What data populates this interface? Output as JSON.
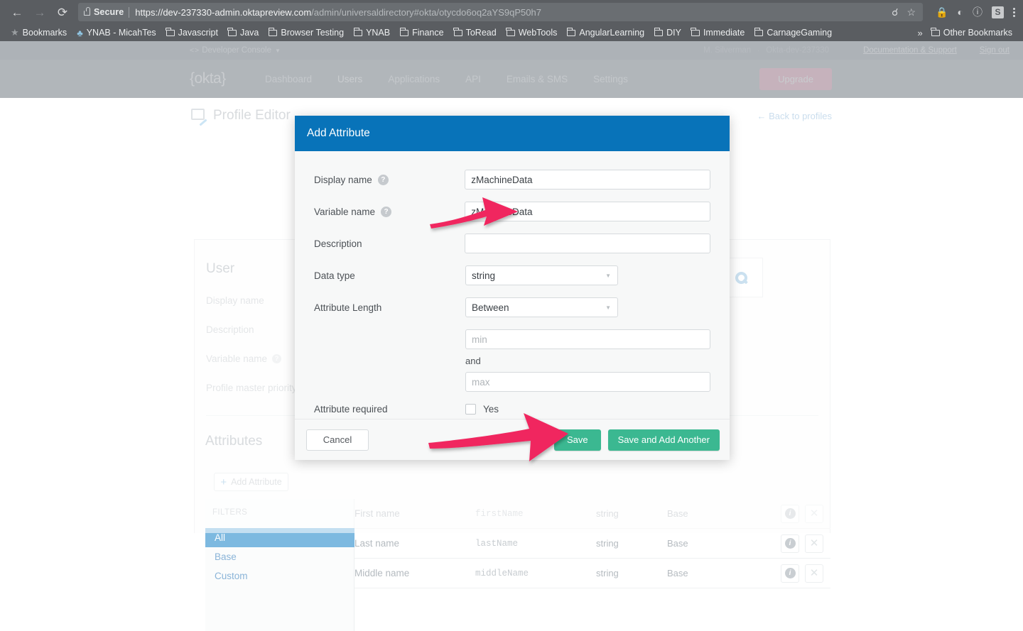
{
  "browser": {
    "nav": {
      "back": "←",
      "forward": "→",
      "reload": "⟳"
    },
    "security_label": "Secure",
    "url_strong": "https://dev-237330-admin.oktapreview.com",
    "url_dim": "/admin/universaldirectory#okta/otycdo6oq2aYS9qP50h7",
    "omni_icons": [
      "zoom-out-icon",
      "bookmark-star-icon"
    ],
    "toolbar_icons": [
      "lock-icon",
      "dark-mode-icon",
      "info-circle-icon"
    ],
    "extension_badge": "S",
    "menu_icon": "kebab-menu-icon",
    "bookmarks": [
      {
        "label": "Bookmarks",
        "icon": "star-icon"
      },
      {
        "label": "YNAB - MicahTes",
        "icon": "tree-icon"
      },
      {
        "label": "Javascript",
        "icon": "folder-icon"
      },
      {
        "label": "Java",
        "icon": "folder-icon"
      },
      {
        "label": "Browser Testing",
        "icon": "folder-icon"
      },
      {
        "label": "YNAB",
        "icon": "folder-icon"
      },
      {
        "label": "Finance",
        "icon": "folder-icon"
      },
      {
        "label": "ToRead",
        "icon": "folder-icon"
      },
      {
        "label": "WebTools",
        "icon": "folder-icon"
      },
      {
        "label": "AngularLearning",
        "icon": "folder-icon"
      },
      {
        "label": "DIY",
        "icon": "folder-icon"
      },
      {
        "label": "Immediate",
        "icon": "folder-icon"
      },
      {
        "label": "CarnageGaming",
        "icon": "folder-icon"
      }
    ],
    "overflow_label": "»",
    "other_bookmarks": "Other Bookmarks"
  },
  "okta": {
    "topbar": {
      "console_label": "Developer Console",
      "console_caret": "▼",
      "user": "M. Silverman",
      "separator": "·",
      "org": "Okta-dev-237330",
      "docs_link": "Documentation & Support",
      "signout_link": "Sign out"
    },
    "nav": {
      "logo": "{okta}",
      "items": [
        {
          "label": "Dashboard",
          "active": false
        },
        {
          "label": "Users",
          "active": true
        },
        {
          "label": "Applications",
          "active": false
        },
        {
          "label": "API",
          "active": false
        },
        {
          "label": "Emails & SMS",
          "active": false
        },
        {
          "label": "Settings",
          "active": false
        }
      ],
      "upgrade_label": "Upgrade"
    },
    "page": {
      "title": "Profile Editor",
      "back_link": "← Back to profiles",
      "section_user": "User",
      "user_fields": [
        {
          "label": "Display name",
          "has_help": false
        },
        {
          "label": "Description",
          "has_help": false
        },
        {
          "label": "Variable name",
          "has_help": true
        },
        {
          "label": "Profile master priority",
          "has_help": true
        }
      ],
      "attributes_title": "Attributes",
      "add_attribute_label": "Add Attribute",
      "filters_label": "FILTERS",
      "filters": [
        {
          "label": "All",
          "selected": true
        },
        {
          "label": "Base",
          "selected": false
        },
        {
          "label": "Custom",
          "selected": false
        }
      ],
      "attribute_rows": [
        {
          "name": "First name",
          "variable": "firstName",
          "type": "string",
          "scope": "Base"
        },
        {
          "name": "Last name",
          "variable": "lastName",
          "type": "string",
          "scope": "Base"
        },
        {
          "name": "Middle name",
          "variable": "middleName",
          "type": "string",
          "scope": "Base"
        }
      ]
    }
  },
  "modal": {
    "title": "Add Attribute",
    "fields": {
      "display_name_label": "Display name",
      "display_name_value": "zMachineData",
      "variable_name_label": "Variable name",
      "variable_name_value": "zMachineData",
      "description_label": "Description",
      "description_value": "",
      "description_placeholder": "",
      "data_type_label": "Data type",
      "data_type_value": "string",
      "attribute_length_label": "Attribute Length",
      "attribute_length_value": "Between",
      "min_placeholder": "min",
      "min_value": "",
      "and_label": "and",
      "max_placeholder": "max",
      "max_value": "",
      "attribute_required_label": "Attribute required",
      "attribute_required_checkbox_label": "Yes",
      "help_glyph": "?"
    },
    "footer": {
      "cancel_label": "Cancel",
      "save_label": "Save",
      "save_add_another_label": "Save and Add Another"
    }
  },
  "annotations": {
    "arrow_color": "#f0285f",
    "arrows": [
      {
        "name": "arrow-to-variable-name-field"
      },
      {
        "name": "arrow-to-save-button"
      }
    ]
  },
  "colors": {
    "modal_header": "#0873b9",
    "save_button": "#3bb891",
    "upgrade_button": "#f4a0b8",
    "filter_selected": "#7db9e0",
    "link_blue": "#8ab4d8"
  }
}
